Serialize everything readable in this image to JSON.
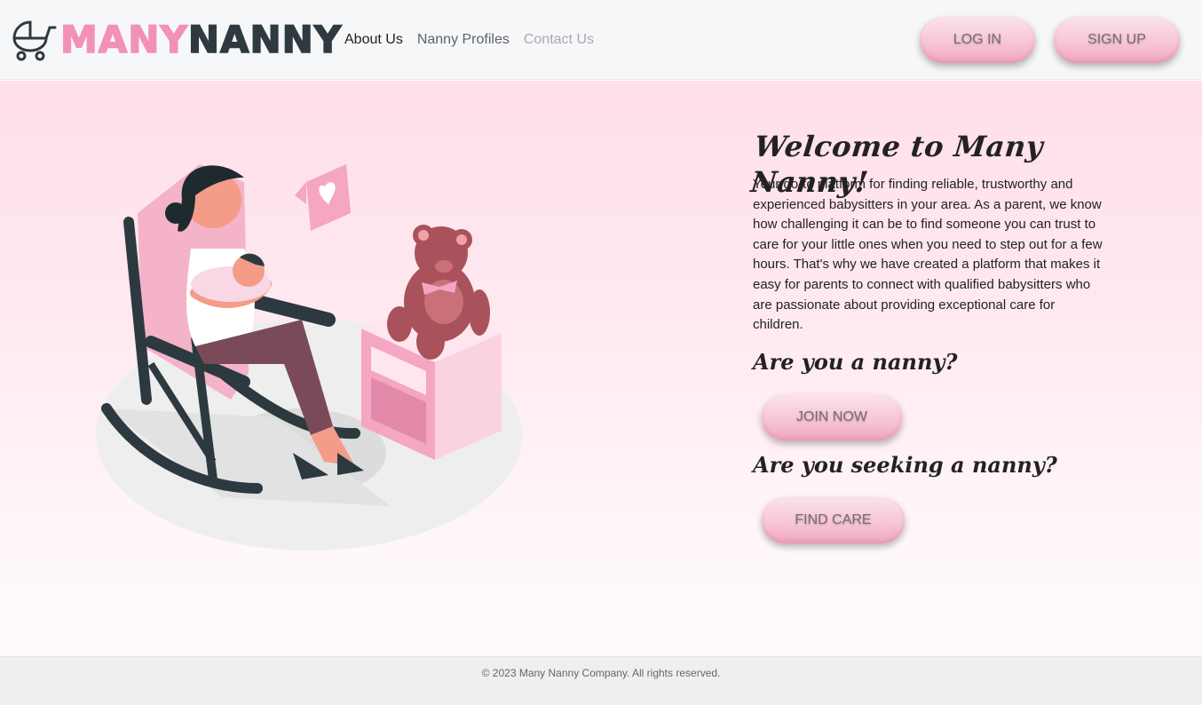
{
  "brand": {
    "part1": "MANY",
    "part2": "NANNY",
    "icon": "baby-stroller-icon",
    "color_pink": "#f291b6",
    "color_dark": "#2e3a40"
  },
  "nav": {
    "items": [
      {
        "label": "About Us"
      },
      {
        "label": "Nanny Profiles"
      },
      {
        "label": "Contact Us"
      }
    ]
  },
  "auth": {
    "login_label": "LOG IN",
    "signup_label": "SIGN UP"
  },
  "hero": {
    "title": "Welcome to Many Nanny!",
    "intro": "Your go-to platform for finding reliable, trustworthy and experienced babysitters in your area. As a parent, we know how challenging it can be to find someone you can trust to care for your little ones when you need to step out for a few hours. That's why we have created a platform that makes it easy for parents to connect with qualified babysitters who are passionate about providing exceptional care for children.",
    "nanny_question": "Are you a nanny?",
    "join_label": "JOIN NOW",
    "seeker_question": "Are you seeking a nanny?",
    "find_label": "FIND CARE",
    "illustration": "mother-rocking-baby-illustration"
  },
  "footer": {
    "copyright": "© 2023 Many Nanny Company. All rights reserved."
  },
  "colors": {
    "accent_pink": "#f7c6d7",
    "hero_top": "#ffdfe9",
    "footer_bg": "#efefef"
  }
}
